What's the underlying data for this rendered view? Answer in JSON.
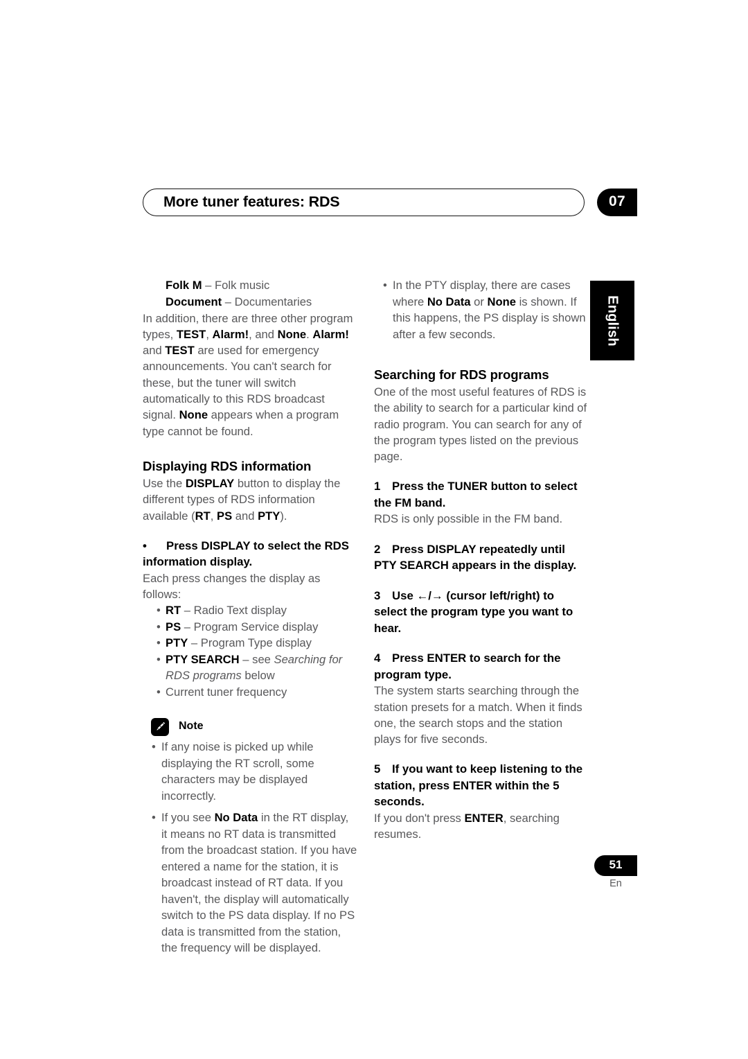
{
  "header": {
    "title": "More tuner features: RDS",
    "chapter": "07"
  },
  "sidebar": {
    "language_tab": "English"
  },
  "left_column": {
    "pty_entries": [
      {
        "term": "Folk M",
        "dash": "–",
        "definition": "Folk music"
      },
      {
        "term": "Document",
        "dash": "–",
        "definition": "Documentaries"
      }
    ],
    "intro_paragraph": {
      "p1": "In addition, there are three other program types, ",
      "b1": "TEST",
      "p2": ", ",
      "b2": "Alarm!",
      "p3": ", and ",
      "b3": "None",
      "p4": ". ",
      "b4": "Alarm!",
      "p5": " and ",
      "b5": "TEST",
      "p6": " are used for emergency announcements. You can't search for these, but the tuner will switch automatically to this RDS broadcast signal. ",
      "b6": "None",
      "p7": " appears when a program type cannot be found."
    },
    "section_heading": "Displaying RDS information",
    "section_intro": {
      "p1": "Use the ",
      "b1": "DISPLAY",
      "p2": " button to display the different types of RDS information available (",
      "b2": "RT",
      "p3": ", ",
      "b3": "PS",
      "p4": " and ",
      "b4": "PTY",
      "p5": ")."
    },
    "command": {
      "bullet": "•",
      "text": "Press DISPLAY to select the RDS information display."
    },
    "command_follow": "Each press changes the display as follows:",
    "display_list": [
      {
        "term": "RT",
        "dash": "–",
        "definition": "Radio Text display",
        "italic": ""
      },
      {
        "term": "PS",
        "dash": "–",
        "definition": "Program Service display",
        "italic": ""
      },
      {
        "term": "PTY",
        "dash": "–",
        "definition": "Program Type display",
        "italic": ""
      },
      {
        "term": "PTY SEARCH",
        "dash": "–",
        "definition": "see ",
        "italic": "Searching for RDS programs",
        "tail": " below"
      },
      {
        "term": "",
        "dash": "",
        "definition": "Current tuner frequency",
        "italic": ""
      }
    ],
    "note": {
      "icon": "pencil-icon",
      "label": "Note",
      "items": [
        {
          "p1": "If any noise is picked up while displaying the RT scroll, some characters may be displayed incorrectly.",
          "b1": "",
          "p2": ""
        },
        {
          "p1": "If you see ",
          "b1": "No Data",
          "p2": " in the RT display, it means no RT data is transmitted from the broadcast station. If you have entered a name for the station, it is broadcast instead of RT data. If you haven't, the display will automatically switch to the PS data display. If no PS data is transmitted from the station, the frequency will be displayed."
        }
      ]
    }
  },
  "right_column": {
    "top_note": {
      "p1": "In the PTY display, there are cases where ",
      "b1": "No Data",
      "p2": " or ",
      "b2": "None",
      "p3": " is shown. If this happens, the PS display is shown after a few seconds."
    },
    "section_heading": "Searching for RDS programs",
    "section_intro": "One of the most useful features of RDS is the ability to search for a particular kind of radio program. You can search for any of the program types listed on the previous page.",
    "steps": [
      {
        "num": "1",
        "title": "Press the TUNER button to select the FM band.",
        "body": "RDS is only possible in the FM band."
      },
      {
        "num": "2",
        "title": "Press DISPLAY repeatedly until PTY SEARCH appears in the display.",
        "body": ""
      },
      {
        "num": "3",
        "title_pre": "Use ",
        "arrow_left": "←",
        "arrow_sep": "/",
        "arrow_right": "→",
        "title_post": " (cursor left/right) to select the program type you want to hear.",
        "body": ""
      },
      {
        "num": "4",
        "title": "Press ENTER to search for the program type.",
        "body": "The system starts searching through the station presets for a match. When it finds one, the search stops and the station plays for five seconds."
      },
      {
        "num": "5",
        "title": "If you want to keep listening to the station, press ENTER within the 5 seconds.",
        "body_p1": "If you don't press ",
        "body_b1": "ENTER",
        "body_p2": ", searching resumes."
      }
    ]
  },
  "footer": {
    "page_number": "51",
    "language_code": "En"
  },
  "colors": {
    "body_text": "#58585a",
    "emphasis_text": "#000000",
    "badge_background": "#000000",
    "badge_text": "#ffffff",
    "page_background": "#ffffff"
  }
}
